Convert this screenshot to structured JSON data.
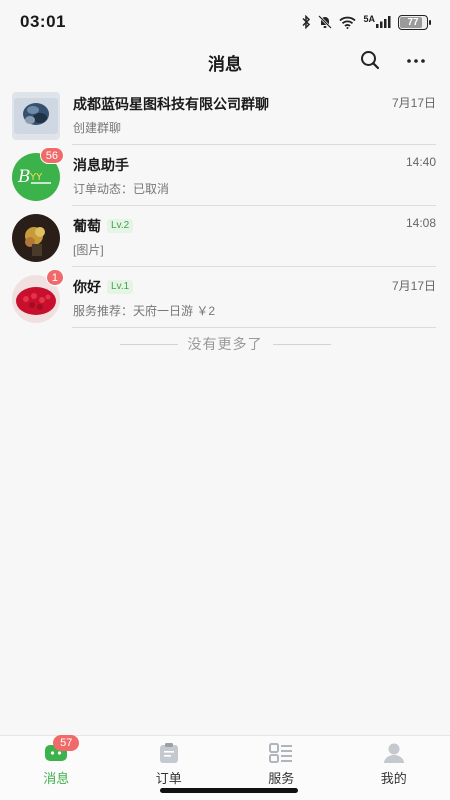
{
  "status_bar": {
    "time": "03:01",
    "network": "5A",
    "battery": "77"
  },
  "header": {
    "title": "消息",
    "search_icon": "search-icon",
    "more_icon": "more-icon"
  },
  "conversations": [
    {
      "name": "成都蓝码星图科技有限公司群聊",
      "preview": "创建群聊",
      "time": "7月17日",
      "avatar": "group-photo",
      "badge": ""
    },
    {
      "name": "消息助手",
      "preview": "订单动态：已取消",
      "time": "14:40",
      "avatar": "assistant-logo",
      "badge": "56"
    },
    {
      "name": "葡萄",
      "level": "Lv.2",
      "preview": "[图片]",
      "time": "14:08",
      "avatar": "user-photo-flowers",
      "badge": ""
    },
    {
      "name": "你好",
      "level": "Lv.1",
      "preview": "服务推荐：天府一日游 ￥2",
      "time": "7月17日",
      "avatar": "user-photo-roses",
      "badge": "1"
    }
  ],
  "no_more_text": "没有更多了",
  "tabs": [
    {
      "label": "消息",
      "icon": "message-icon",
      "badge": "57",
      "active": true
    },
    {
      "label": "订单",
      "icon": "order-icon",
      "active": false
    },
    {
      "label": "服务",
      "icon": "service-icon",
      "active": false
    },
    {
      "label": "我的",
      "icon": "profile-icon",
      "active": false
    }
  ],
  "colors": {
    "accent": "#3bb24a",
    "badge": "#f06a6a",
    "background": "#f7f7f7"
  }
}
